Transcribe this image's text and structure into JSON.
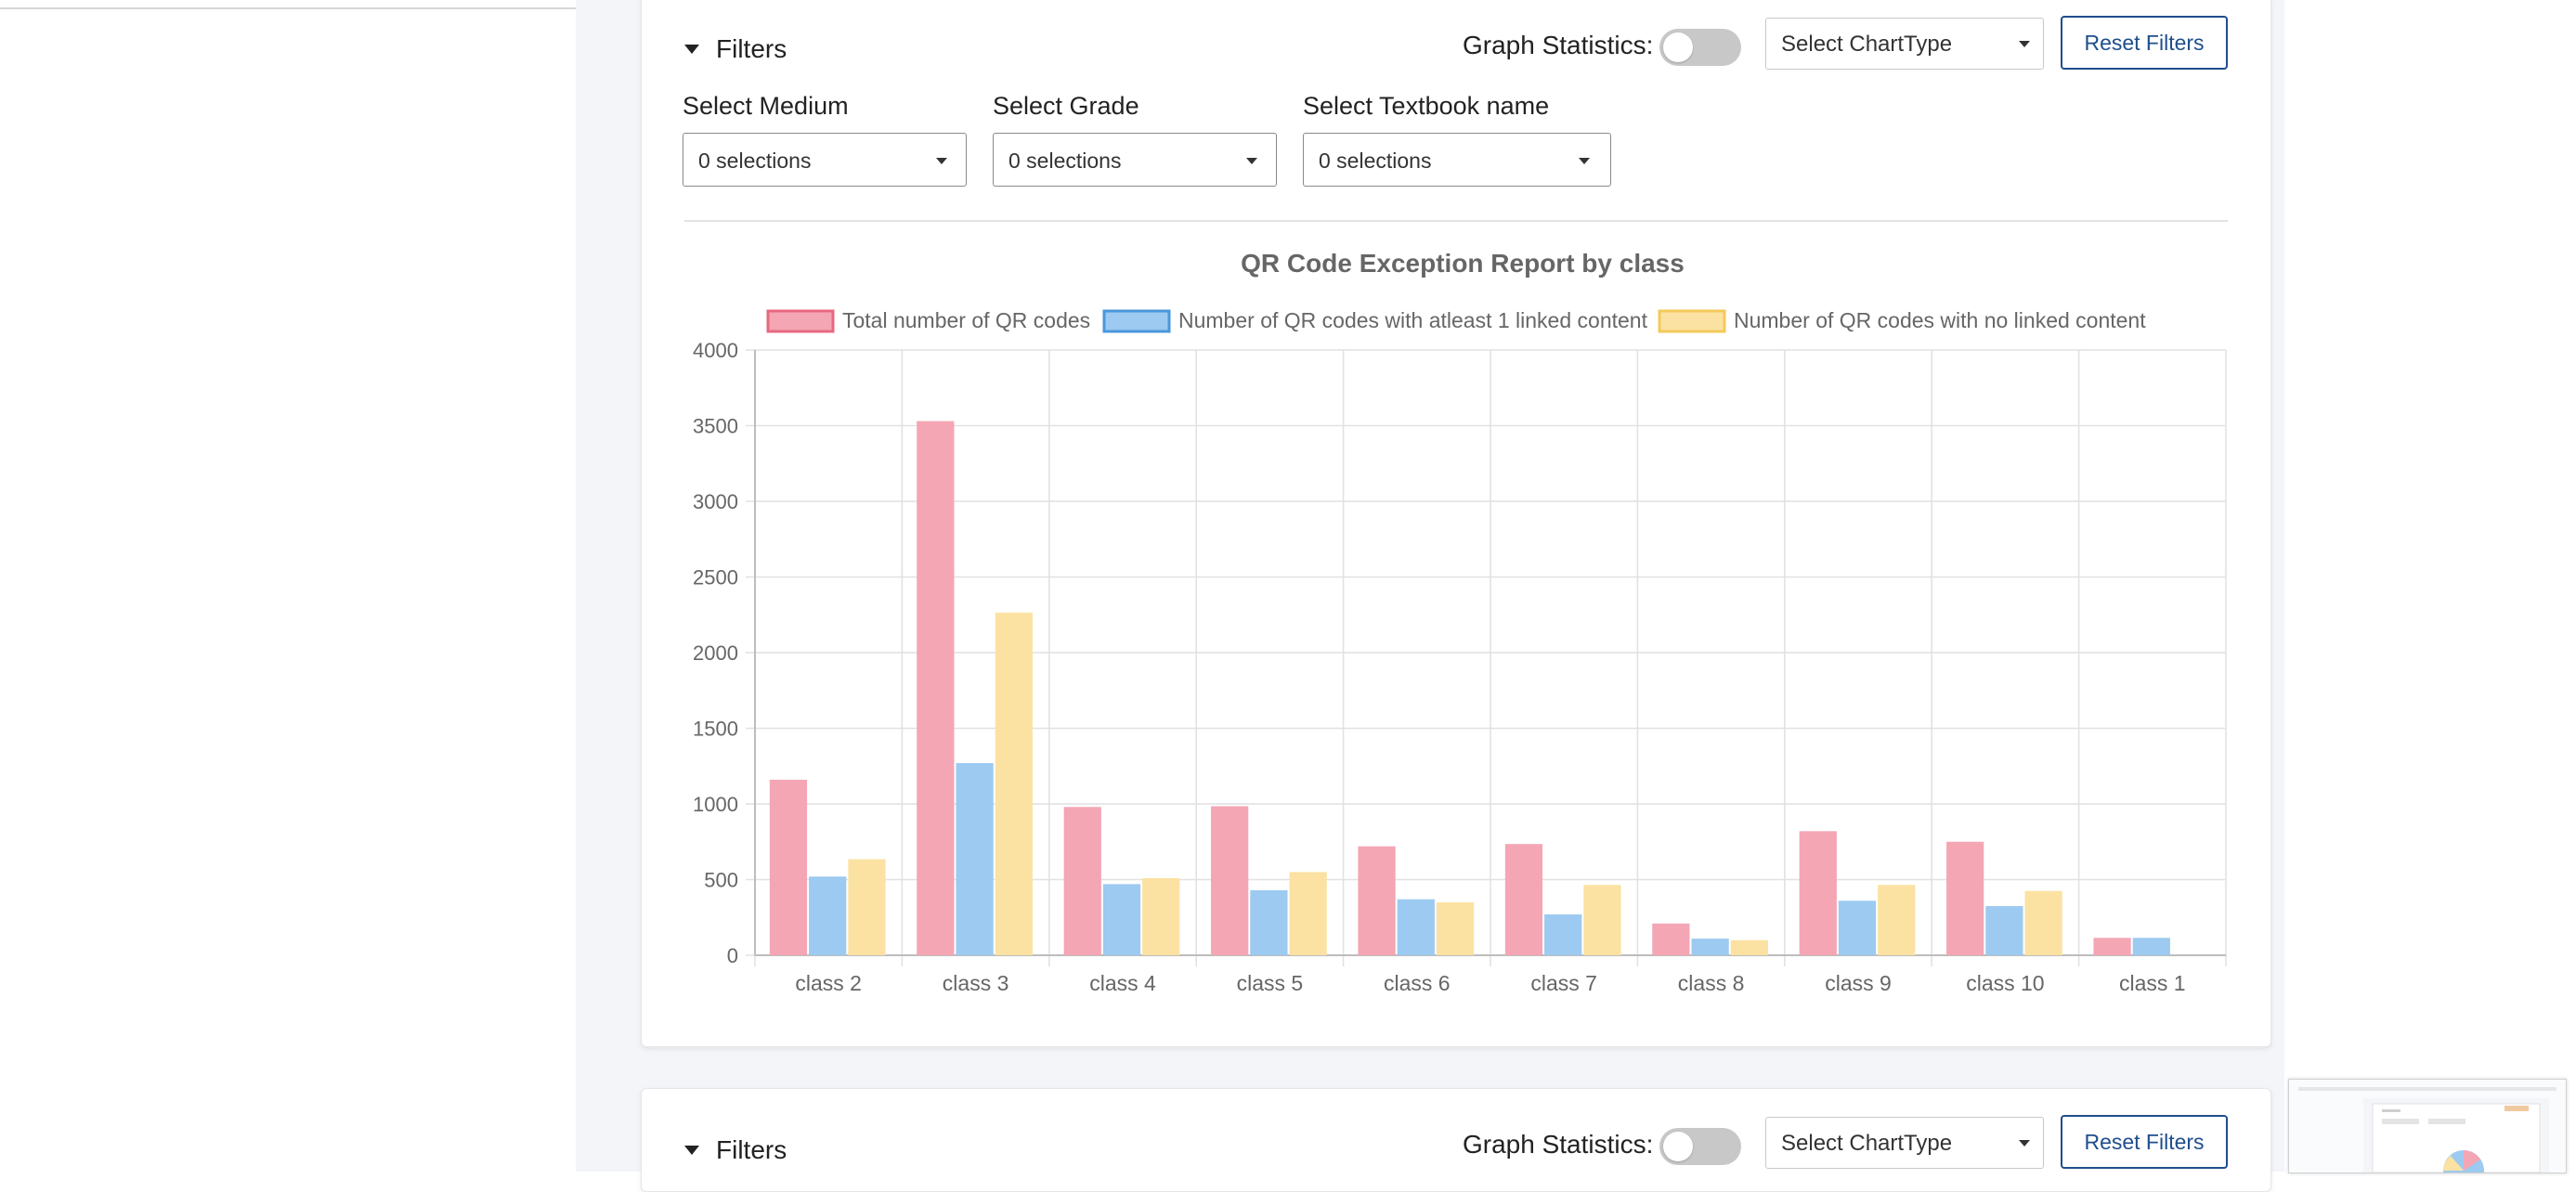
{
  "filters": {
    "toggle_label": "Filters",
    "graph_statistics_label": "Graph Statistics:",
    "graph_statistics_enabled": false,
    "chart_type_placeholder": "Select ChartType",
    "reset_label": "Reset Filters",
    "medium": {
      "label": "Select Medium",
      "value": "0 selections"
    },
    "grade": {
      "label": "Select Grade",
      "value": "0 selections"
    },
    "textbook": {
      "label": "Select Textbook name",
      "value": "0 selections"
    }
  },
  "filters2": {
    "toggle_label": "Filters",
    "graph_statistics_label": "Graph Statistics:",
    "chart_type_placeholder": "Select ChartType",
    "reset_label": "Reset Filters"
  },
  "chart_data": {
    "type": "bar",
    "title": "QR Code Exception Report by class",
    "xlabel": "",
    "ylabel": "",
    "ylim": [
      0,
      4000
    ],
    "yticks": [
      0,
      500,
      1000,
      1500,
      2000,
      2500,
      3000,
      3500,
      4000
    ],
    "grid": true,
    "legend_position": "top",
    "categories": [
      "class 2",
      "class 3",
      "class 4",
      "class 5",
      "class 6",
      "class 7",
      "class 8",
      "class 9",
      "class 10",
      "class 1"
    ],
    "series": [
      {
        "name": "Total number of QR codes",
        "color": "#f4a6b4",
        "border": "#e8687f",
        "values": [
          1160,
          3530,
          980,
          985,
          720,
          735,
          210,
          820,
          750,
          115
        ]
      },
      {
        "name": "Number of QR codes with atleast 1 linked content",
        "color": "#9ccaf0",
        "border": "#4a97dc",
        "values": [
          520,
          1270,
          470,
          430,
          370,
          270,
          110,
          360,
          325,
          115
        ]
      },
      {
        "name": "Number of QR codes with no linked content",
        "color": "#fbe2a3",
        "border": "#f3c95a",
        "values": [
          635,
          2265,
          510,
          550,
          350,
          465,
          100,
          465,
          425,
          0
        ]
      }
    ]
  }
}
